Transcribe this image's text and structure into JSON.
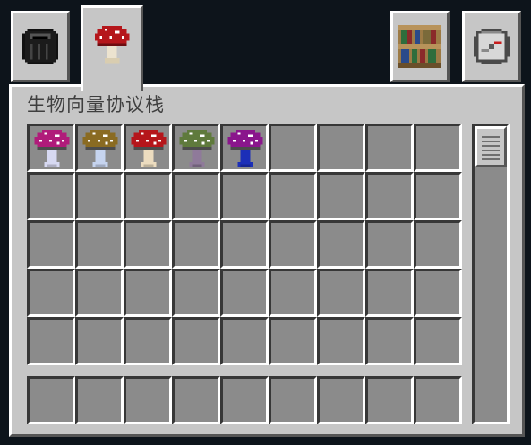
{
  "window": {
    "title": "生物向量协议栈"
  },
  "tabs": [
    {
      "id": "tab-storage",
      "icon": "black-barrel-icon",
      "active": false
    },
    {
      "id": "tab-mushrooms",
      "icon": "red-mushroom-icon",
      "active": true
    },
    {
      "id": "tab-bookshelf",
      "icon": "bookshelf-icon",
      "active": false
    },
    {
      "id": "tab-compass",
      "icon": "compass-icon",
      "active": false
    }
  ],
  "grid": {
    "rows": 5,
    "columns": 9
  },
  "hotbar": {
    "columns": 9
  },
  "items": [
    {
      "slot": 0,
      "icon": "magenta-mushroom-icon",
      "cap": "#b01b7a",
      "stem": "#d7d9f2"
    },
    {
      "slot": 1,
      "icon": "brown-mushroom-icon",
      "cap": "#8a6b22",
      "stem": "#c6d4ef"
    },
    {
      "slot": 2,
      "icon": "red-mushroom-icon",
      "cap": "#b5161b",
      "stem": "#ecdcbf"
    },
    {
      "slot": 3,
      "icon": "green-mushroom-icon",
      "cap": "#5f7a3c",
      "stem": "#8f7a9a"
    },
    {
      "slot": 4,
      "icon": "purple-mushroom-icon",
      "cap": "#8a168c",
      "stem": "#1c2fb8"
    }
  ],
  "scrollbar": {
    "position": 0
  }
}
